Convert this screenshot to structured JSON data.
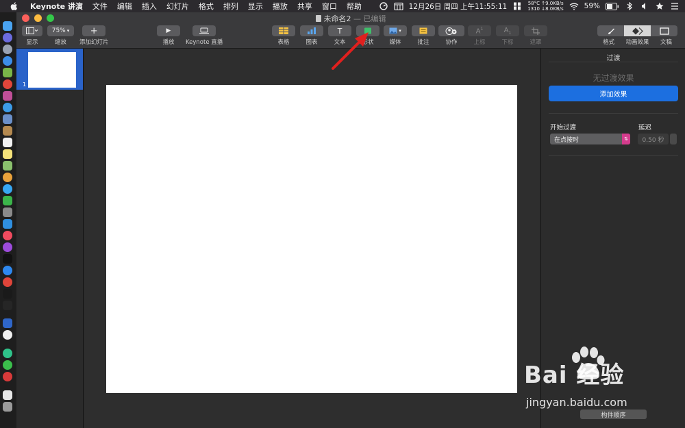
{
  "menubar": {
    "app_name": "Keynote 讲演",
    "items": [
      "文件",
      "编辑",
      "插入",
      "幻灯片",
      "格式",
      "排列",
      "显示",
      "播放",
      "共享",
      "窗口",
      "帮助"
    ],
    "cpu_temp": "58°C",
    "fan": "1310",
    "net_up": "↑9.0KB/s",
    "net_down": "↓8.0KB/s",
    "datetime": "12月26日 周四 上午11:55:11",
    "battery": "59%"
  },
  "window": {
    "doc_title": "未命名2",
    "edited_status": "— 已编辑"
  },
  "toolbar": {
    "view_label": "显示",
    "zoom_value": "75%",
    "zoom_label": "缩放",
    "add_slide_label": "添加幻灯片",
    "play_label": "播放",
    "live_label": "Keynote 直播",
    "table_label": "表格",
    "chart_label": "图表",
    "text_label": "文本",
    "shape_label": "形状",
    "media_label": "媒体",
    "comment_label": "批注",
    "collab_label": "协作",
    "superscript_label": "上标",
    "subscript_label": "下标",
    "mask_label": "遮罩",
    "format_label": "格式",
    "animate_label": "动画效果",
    "document_label": "文稿"
  },
  "navigator": {
    "slide_number": "1"
  },
  "inspector": {
    "header": "过渡",
    "no_effect": "无过渡效果",
    "add_effect": "添加效果",
    "start_label": "开始过渡",
    "start_value": "在点按时",
    "delay_label": "延迟",
    "delay_value": "0.50 秒",
    "build_order": "构件顺序"
  },
  "watermark": {
    "brand": "Bai 经验",
    "url": "jingyan.baidu.com"
  },
  "colors": {
    "accent_blue": "#1c6fe0",
    "selection_blue": "#2a63c9",
    "popup_chevron": "#d43c8d",
    "arrow_red": "#e0201e"
  }
}
